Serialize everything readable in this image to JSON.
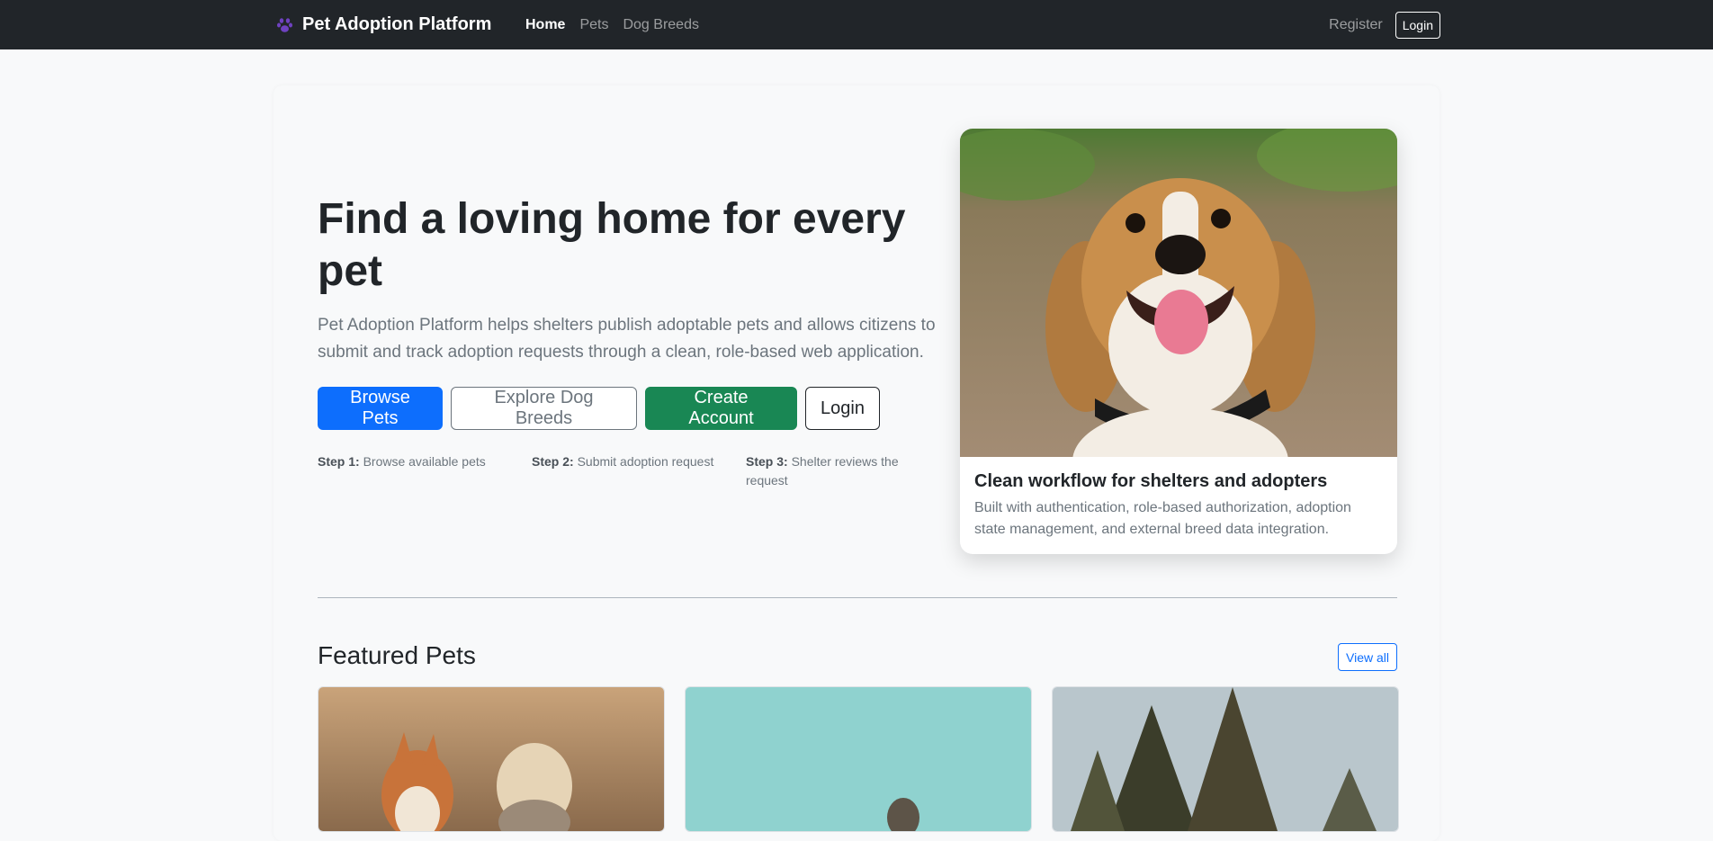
{
  "navbar": {
    "brand_icon": "paw-icon",
    "brand": "Pet Adoption Platform",
    "links": [
      {
        "label": "Home",
        "active": true
      },
      {
        "label": "Pets",
        "active": false
      },
      {
        "label": "Dog Breeds",
        "active": false
      }
    ],
    "register": "Register",
    "login": "Login"
  },
  "hero": {
    "title": "Find a loving home for every pet",
    "lead": "Pet Adoption Platform helps shelters publish adoptable pets and allows citizens to submit and track adoption requests through a clean, role-based web application.",
    "buttons": {
      "browse": "Browse Pets",
      "breeds": "Explore Dog Breeds",
      "create": "Create Account",
      "login": "Login"
    },
    "steps": [
      {
        "label": "Step 1:",
        "text": "Browse available pets"
      },
      {
        "label": "Step 2:",
        "text": "Submit adoption request"
      },
      {
        "label": "Step 3:",
        "text": "Shelter reviews the request"
      }
    ]
  },
  "feature": {
    "title": "Clean workflow for shelters and adopters",
    "text": "Built with authentication, role-based authorization, adoption state management, and external breed data integration."
  },
  "featured": {
    "title": "Featured Pets",
    "view_all": "View all"
  },
  "colors": {
    "navbar": "#212529",
    "primary": "#0d6efd",
    "success": "#198754",
    "secondary": "#6c757d"
  }
}
